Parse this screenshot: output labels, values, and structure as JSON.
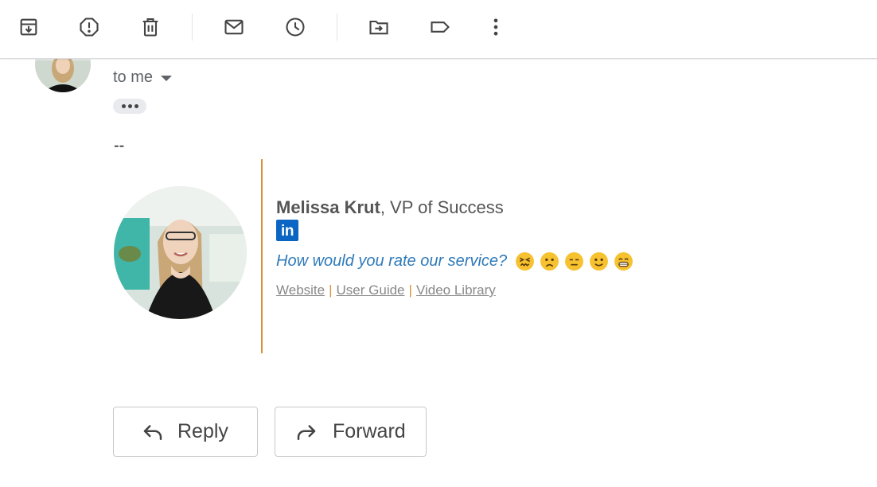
{
  "toolbar": {
    "buttons": [
      {
        "name": "archive",
        "icon": "archive-icon"
      },
      {
        "name": "report-spam",
        "icon": "report-spam-icon"
      },
      {
        "name": "delete",
        "icon": "trash-icon"
      },
      {
        "name": "mark-unread",
        "icon": "mail-icon"
      },
      {
        "name": "snooze",
        "icon": "clock-icon"
      },
      {
        "name": "move-to",
        "icon": "move-to-folder-icon"
      },
      {
        "name": "labels",
        "icon": "label-icon"
      },
      {
        "name": "more",
        "icon": "more-vert-icon"
      }
    ]
  },
  "email": {
    "recipient_text": "to me"
  },
  "signature": {
    "dash": "--",
    "name": "Melissa Krut",
    "title": ", VP of Success",
    "linkedin_label": "in",
    "rating_prompt": "How would you rate our service?",
    "rating_emojis": [
      "very-unhappy-icon",
      "sad-icon",
      "neutral-icon",
      "smile-icon",
      "grin-icon"
    ],
    "links": [
      "Website",
      "User Guide",
      "Video Library"
    ],
    "separator": "|",
    "accent_color": "#d9923a",
    "link_color": "#2f7ab9"
  },
  "actions": {
    "reply_label": "Reply",
    "forward_label": "Forward"
  }
}
